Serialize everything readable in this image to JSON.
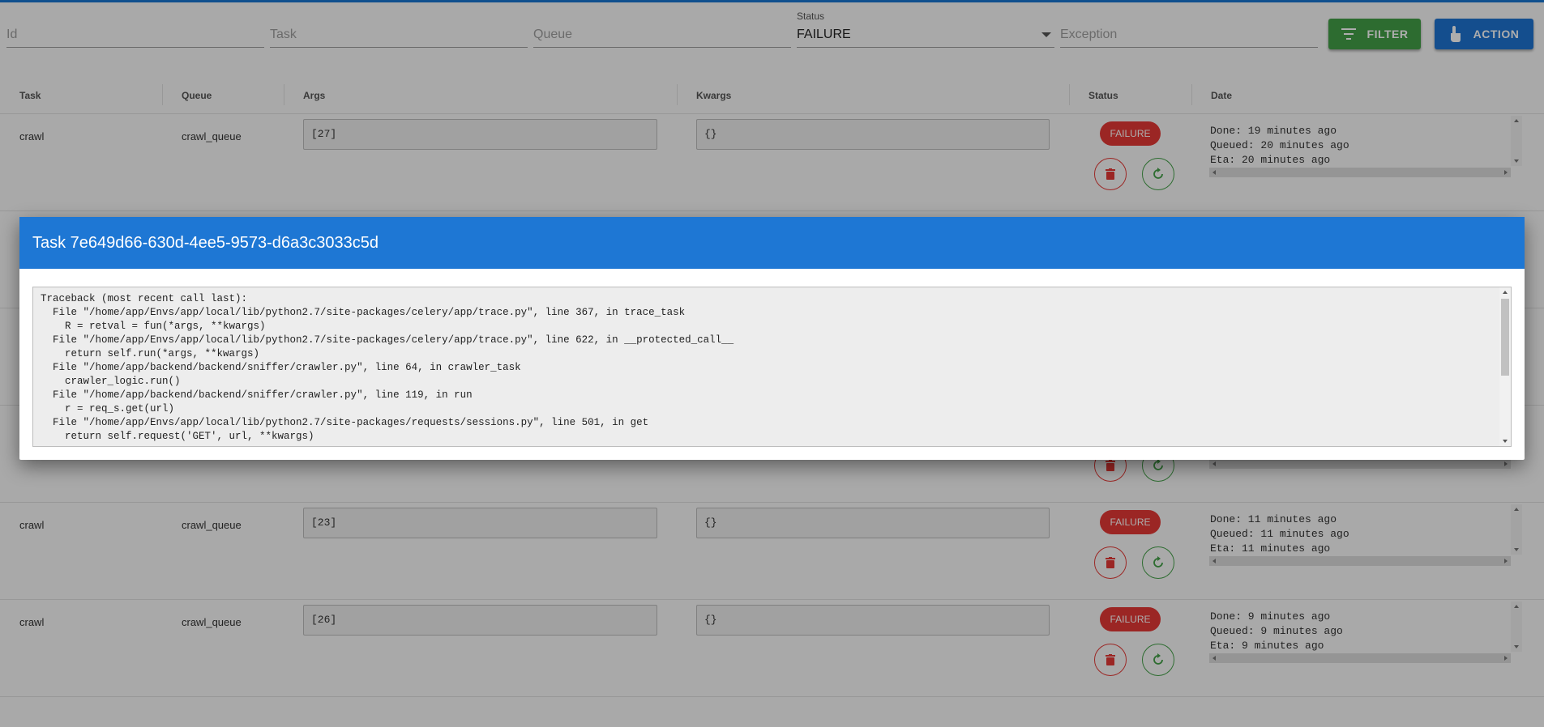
{
  "filters": {
    "id_placeholder": "Id",
    "task_placeholder": "Task",
    "queue_placeholder": "Queue",
    "status_label": "Status",
    "status_value": "FAILURE",
    "exception_placeholder": "Exception",
    "filter_button": "FILTER",
    "action_button": "ACTION"
  },
  "table": {
    "headers": {
      "task": "Task",
      "queue": "Queue",
      "args": "Args",
      "kwargs": "Kwargs",
      "status": "Status",
      "date": "Date"
    },
    "rows": [
      {
        "task": "crawl",
        "queue": "crawl_queue",
        "args": "[27]",
        "kwargs": "{}",
        "status": "FAILURE",
        "done": "Done: 19 minutes ago",
        "queued": "Queued: 20 minutes ago",
        "eta": "Eta: 20 minutes ago"
      },
      {
        "task": "crawl",
        "queue": "crawl_queue",
        "args": "[23]",
        "kwargs": "{}",
        "status": "FAILURE",
        "done": "Done: 11 minutes ago",
        "queued": "Queued: 11 minutes ago",
        "eta": "Eta: 11 minutes ago"
      },
      {
        "task": "crawl",
        "queue": "crawl_queue",
        "args": "[26]",
        "kwargs": "{}",
        "status": "FAILURE",
        "done": "Done: 9 minutes ago",
        "queued": "Queued: 9 minutes ago",
        "eta": "Eta: 9 minutes ago"
      }
    ]
  },
  "modal": {
    "title": "Task 7e649d66-630d-4ee5-9573-d6a3c3033c5d",
    "traceback": "Traceback (most recent call last):\n  File \"/home/app/Envs/app/local/lib/python2.7/site-packages/celery/app/trace.py\", line 367, in trace_task\n    R = retval = fun(*args, **kwargs)\n  File \"/home/app/Envs/app/local/lib/python2.7/site-packages/celery/app/trace.py\", line 622, in __protected_call__\n    return self.run(*args, **kwargs)\n  File \"/home/app/backend/backend/sniffer/crawler.py\", line 64, in crawler_task\n    crawler_logic.run()\n  File \"/home/app/backend/backend/sniffer/crawler.py\", line 119, in run\n    r = req_s.get(url)\n  File \"/home/app/Envs/app/local/lib/python2.7/site-packages/requests/sessions.py\", line 501, in get\n    return self.request('GET', url, **kwargs)"
  },
  "colors": {
    "primary": "#1e77d4",
    "success": "#43a047",
    "danger": "#e53935"
  },
  "icons": {
    "filter": "filter-list-icon",
    "action": "touch-hand-icon",
    "delete": "trash-icon",
    "retry": "refresh-icon"
  }
}
